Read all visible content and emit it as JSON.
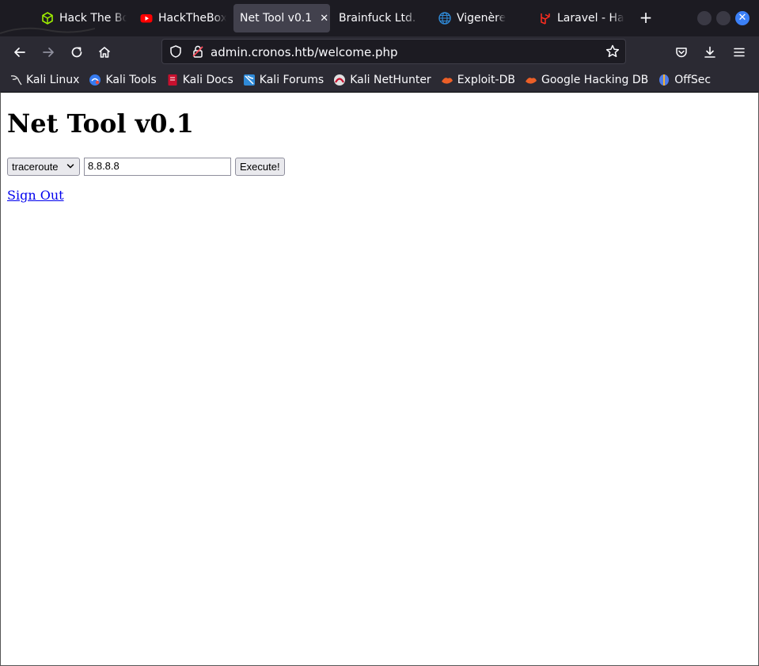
{
  "tabs": [
    {
      "title": "Hack The Box",
      "icon": "htb-cube-icon",
      "active": false
    },
    {
      "title": "HackTheBox",
      "icon": "youtube-icon",
      "active": false
    },
    {
      "title": "Net Tool v0.1",
      "icon": "",
      "active": true
    },
    {
      "title": "Brainfuck Ltd. –",
      "icon": "",
      "active": false
    },
    {
      "title": "Vigenère",
      "icon": "globe-icon",
      "active": false
    },
    {
      "title": "Laravel - Hac",
      "icon": "laravel-icon",
      "active": false
    }
  ],
  "new_tab_label": "+",
  "url": "admin.cronos.htb/welcome.php",
  "bookmarks": [
    {
      "label": "Kali Linux",
      "icon": "kali-dragon-icon"
    },
    {
      "label": "Kali Tools",
      "icon": "kali-tools-icon"
    },
    {
      "label": "Kali Docs",
      "icon": "kali-docs-icon"
    },
    {
      "label": "Kali Forums",
      "icon": "kali-forums-icon"
    },
    {
      "label": "Kali NetHunter",
      "icon": "nethunter-icon"
    },
    {
      "label": "Exploit-DB",
      "icon": "exploit-db-icon"
    },
    {
      "label": "Google Hacking DB",
      "icon": "ghdb-icon"
    },
    {
      "label": "OffSec",
      "icon": "offsec-icon"
    }
  ],
  "page": {
    "heading": "Net Tool v0.1",
    "command_select": "traceroute",
    "host_value": "8.8.8.8",
    "execute_label": "Execute!",
    "signout_label": "Sign Out"
  },
  "colors": {
    "link": "#0000ee",
    "active_tab": "#42414d",
    "close_button": "#3b80f7"
  }
}
